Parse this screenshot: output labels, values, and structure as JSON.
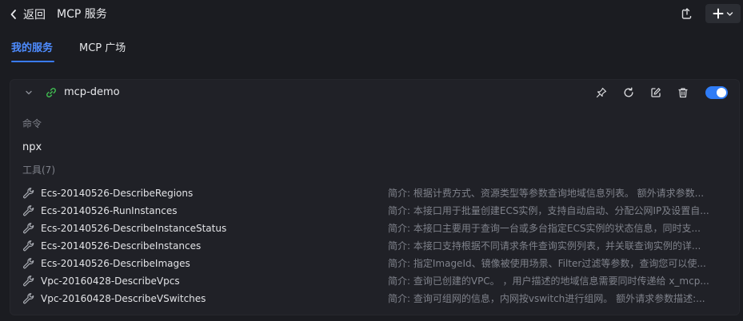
{
  "header": {
    "back_label": "返回",
    "title": "MCP 服务"
  },
  "tabs": [
    {
      "label": "我的服务",
      "active": true
    },
    {
      "label": "MCP 广场",
      "active": false
    }
  ],
  "server": {
    "name": "mcp-demo",
    "enabled": true,
    "command_label": "命令",
    "command_value": "npx",
    "tools_label": "工具(7)",
    "tools": [
      {
        "name": "Ecs-20140526-DescribeRegions",
        "desc": "简介: 根据计费方式、资源类型等参数查询地域信息列表。 额外请求参数..."
      },
      {
        "name": "Ecs-20140526-RunInstances",
        "desc": "简介: 本接口用于批量创建ECS实例，支持自动启动、分配公网IP及设置自..."
      },
      {
        "name": "Ecs-20140526-DescribeInstanceStatus",
        "desc": "简介: 本接口主要用于查询一台或多台指定ECS实例的状态信息，同时支..."
      },
      {
        "name": "Ecs-20140526-DescribeInstances",
        "desc": "简介: 本接口支持根据不同请求条件查询实例列表，并关联查询实例的详..."
      },
      {
        "name": "Ecs-20140526-DescribeImages",
        "desc": "简介: 指定ImageId、镜像被使用场景、Filter过滤等参数，查询您可以使..."
      },
      {
        "name": "Vpc-20160428-DescribeVpcs",
        "desc": "简介: 查询已创建的VPC。 ，用户描述的地域信息需要同时传递给 x_mcp..."
      },
      {
        "name": "Vpc-20160428-DescribeVSwitches",
        "desc": "简介: 查询可组网的信息，内网按vswitch进行组网。 额外请求参数描述:..."
      }
    ]
  },
  "icons": {
    "back": "chevron-left-icon",
    "share": "share-icon",
    "add": "plus-icon",
    "dropdown": "chevron-down-icon",
    "collapse": "chevron-down-icon",
    "link": "link-icon",
    "pin": "pin-icon",
    "refresh": "refresh-icon",
    "edit": "edit-icon",
    "delete": "trash-icon",
    "tool": "wrench-icon"
  },
  "colors": {
    "background": "#1b1c21",
    "card": "#202127",
    "accent": "#3a7bfd",
    "link_green": "#3fb950",
    "muted_text": "#7f828b"
  }
}
